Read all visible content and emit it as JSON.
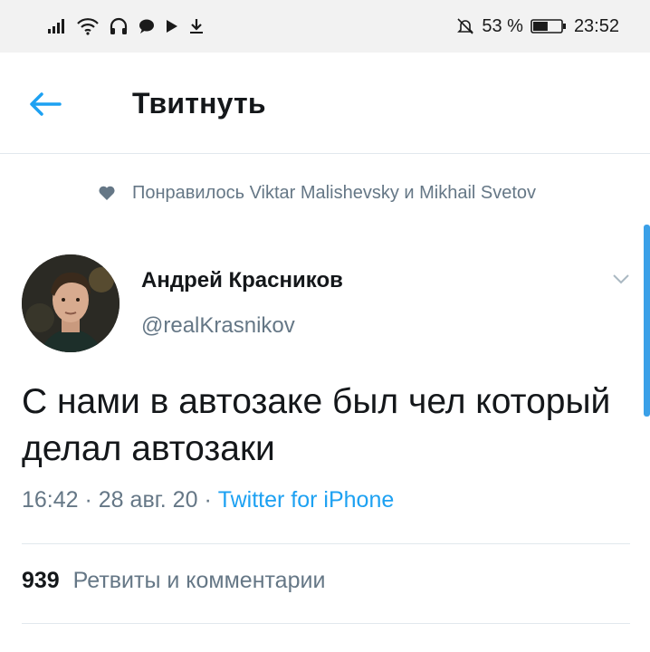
{
  "status_bar": {
    "battery_percent": "53 %",
    "time": "23:52",
    "left_icons": [
      "signal-icon",
      "wifi-icon",
      "headphones-icon",
      "message-icon",
      "play-icon",
      "download-icon"
    ],
    "right_icons": [
      "bell-off-icon",
      "battery-icon"
    ],
    "battery_level": 0.53
  },
  "header": {
    "title": "Твитнуть",
    "back_icon": "back-arrow-icon"
  },
  "social_context": {
    "icon": "heart-icon",
    "text": "Понравилось Viktar Malishevsky и Mikhail Svetov"
  },
  "tweet": {
    "author_name": "Андрей Красников",
    "author_handle": "@realKrasnikov",
    "text": "С нами в автозаке был чел который делал автозаки",
    "time": "16:42",
    "sep1": " · ",
    "date": "28 авг. 20",
    "sep2": " · ",
    "source": "Twitter for iPhone"
  },
  "stats": {
    "count": "939",
    "label": "Ретвиты и комментарии"
  },
  "colors": {
    "accent": "#1da1f2",
    "secondary_text": "#657786",
    "primary_text": "#14171a",
    "divider": "#e1e8ed"
  }
}
